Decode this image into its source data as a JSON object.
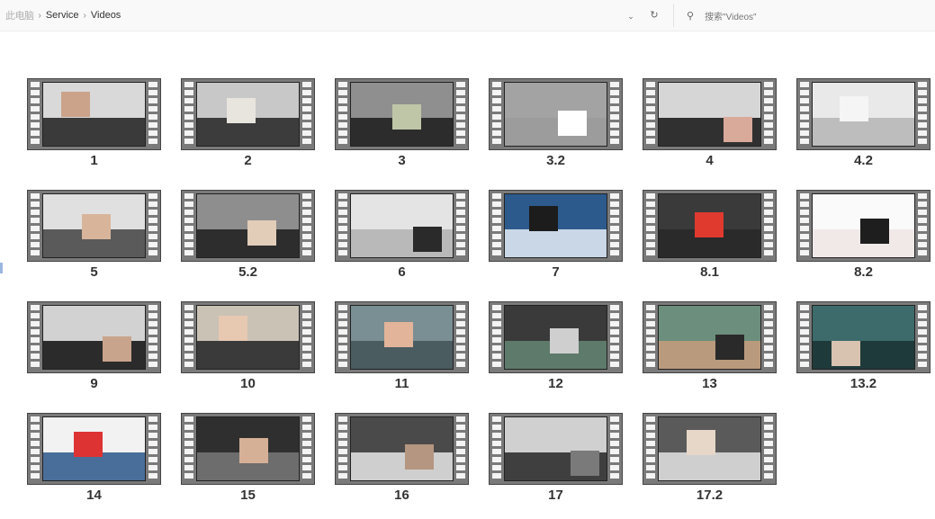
{
  "address_bar": {
    "root": "此电脑",
    "path": [
      "Service",
      "Videos"
    ],
    "dropdown_icon": "chevron-down-icon",
    "refresh_icon": "refresh-icon"
  },
  "search": {
    "icon": "search-icon",
    "placeholder": "搜索\"Videos\""
  },
  "files": [
    {
      "label": "1",
      "colors": [
        "#d9d9d9",
        "#3a3a3a",
        "#caa38a"
      ]
    },
    {
      "label": "2",
      "colors": [
        "#c8c8c8",
        "#3c3c3c",
        "#e8e4de"
      ]
    },
    {
      "label": "3",
      "colors": [
        "#8f8f8f",
        "#2c2c2c",
        "#bfc6a8"
      ]
    },
    {
      "label": "3.2",
      "colors": [
        "#a3a3a3",
        "#9c9c9c",
        "#ffffff"
      ]
    },
    {
      "label": "4",
      "colors": [
        "#d6d6d6",
        "#303030",
        "#d9a99a"
      ]
    },
    {
      "label": "4.2",
      "colors": [
        "#e9e9e9",
        "#bdbdbd",
        "#f5f5f5"
      ]
    },
    {
      "label": "5",
      "colors": [
        "#e0e0e0",
        "#5a5a5a",
        "#d8b59a"
      ]
    },
    {
      "label": "5.2",
      "colors": [
        "#8e8e8e",
        "#2d2d2d",
        "#e2cdb9"
      ]
    },
    {
      "label": "6",
      "colors": [
        "#e4e4e4",
        "#b9b9b9",
        "#2a2a2a"
      ]
    },
    {
      "label": "7",
      "colors": [
        "#2c5a8c",
        "#c9d7e6",
        "#1c1c1c"
      ]
    },
    {
      "label": "8.1",
      "colors": [
        "#3a3a3a",
        "#2a2a2a",
        "#e03a2e"
      ]
    },
    {
      "label": "8.2",
      "colors": [
        "#fafafa",
        "#f1e8e8",
        "#1e1e1e"
      ]
    },
    {
      "label": "9",
      "colors": [
        "#d2d2d2",
        "#2b2b2b",
        "#c9a48c"
      ]
    },
    {
      "label": "10",
      "colors": [
        "#c9c2b5",
        "#3a3a3a",
        "#e7c9b2"
      ]
    },
    {
      "label": "11",
      "colors": [
        "#7a8f93",
        "#4a5c60",
        "#e2b49a"
      ]
    },
    {
      "label": "12",
      "colors": [
        "#3a3a3a",
        "#5e7a6a",
        "#cfcfcf"
      ]
    },
    {
      "label": "13",
      "colors": [
        "#6b8f7c",
        "#ba9a7c",
        "#2a2a2a"
      ]
    },
    {
      "label": "13.2",
      "colors": [
        "#3d6b6b",
        "#1f3a3a",
        "#d8c2b0"
      ]
    },
    {
      "label": "14",
      "colors": [
        "#f2f2f2",
        "#4a6e9a",
        "#dd3333"
      ]
    },
    {
      "label": "15",
      "colors": [
        "#2f2f2f",
        "#6d6d6d",
        "#d6b096"
      ]
    },
    {
      "label": "16",
      "colors": [
        "#4a4a4a",
        "#cfcfcf",
        "#b59680"
      ]
    },
    {
      "label": "17",
      "colors": [
        "#d0d0d0",
        "#3f3f3f",
        "#7a7a7a"
      ]
    },
    {
      "label": "17.2",
      "colors": [
        "#5a5a5a",
        "#cfcfcf",
        "#e6d7c8"
      ]
    }
  ]
}
